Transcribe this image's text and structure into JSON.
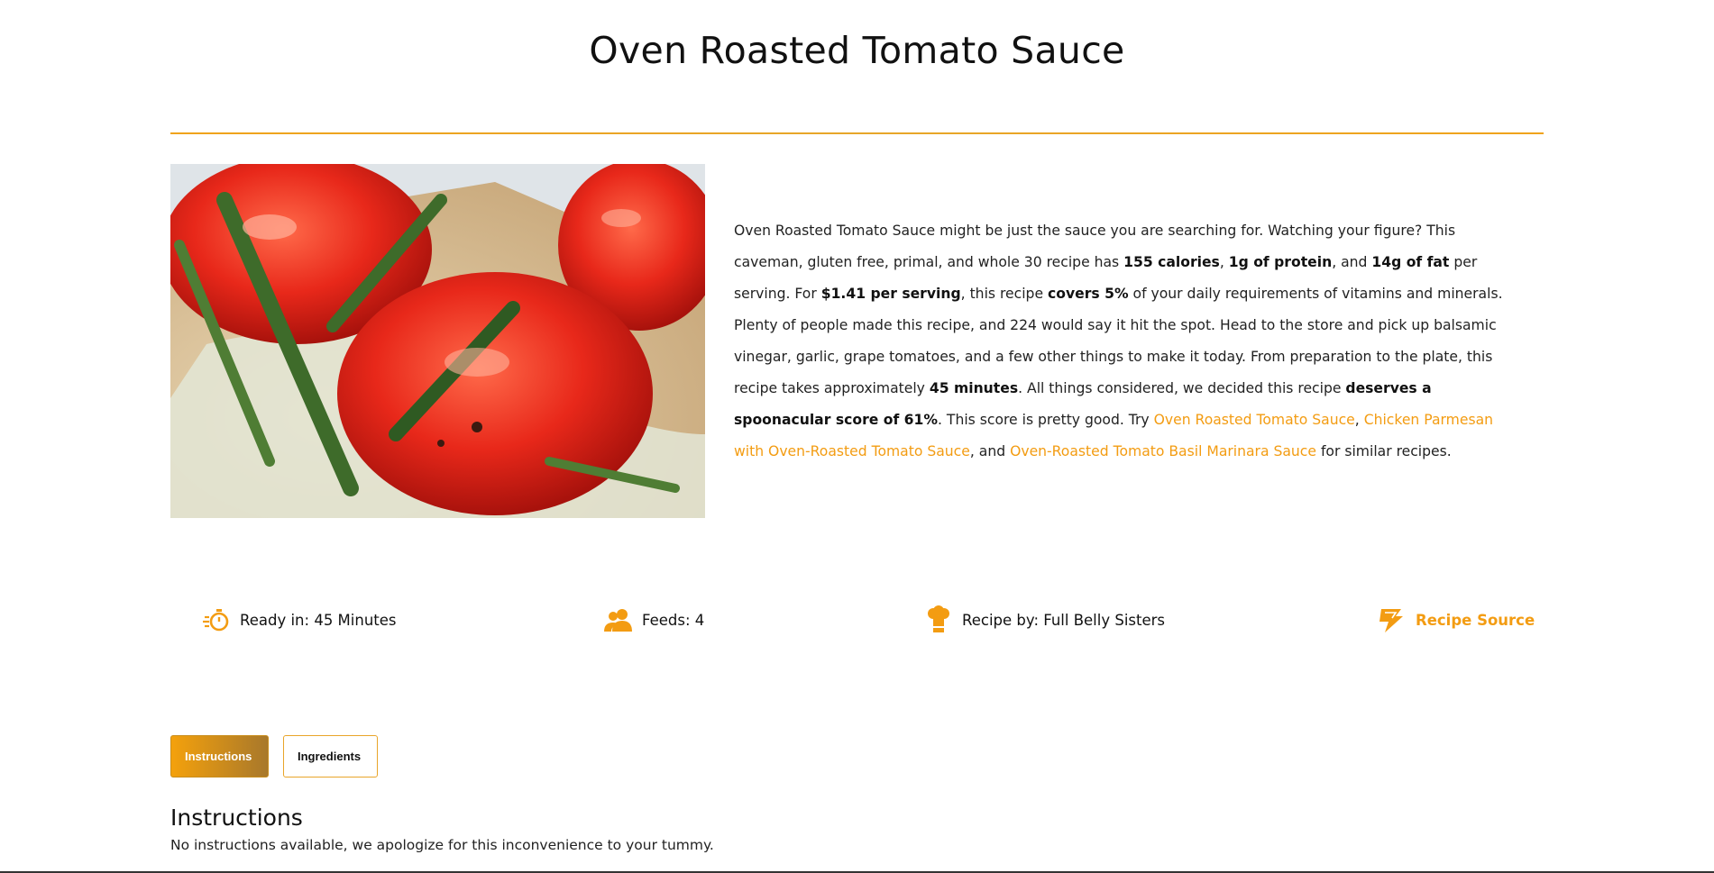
{
  "recipe": {
    "title": "Oven Roasted Tomato Sauce"
  },
  "summary": {
    "p1": "Oven Roasted Tomato Sauce might be just the sauce you are searching for. Watching your figure? This caveman, gluten free, primal, and whole 30 recipe has ",
    "b1": "155 calories",
    "p2": ", ",
    "b2": "1g of protein",
    "p3": ", and ",
    "b3": "14g of fat",
    "p4": " per serving. For ",
    "b4": "$1.41 per serving",
    "p5": ", this recipe ",
    "b5": "covers 5%",
    "p6": " of your daily requirements of vitamins and minerals. Plenty of people made this recipe, and 224 would say it hit the spot. Head to the store and pick up balsamic vinegar, garlic, grape tomatoes, and a few other things to make it today. From preparation to the plate, this recipe takes approximately ",
    "b6": "45 minutes",
    "p7": ". All things considered, we decided this recipe ",
    "b7": "deserves a spoonacular score of 61%",
    "p8": ". This score is pretty good. Try ",
    "link1": "Oven Roasted Tomato Sauce",
    "p9": ", ",
    "link2": "Chicken Parmesan with Oven-Roasted Tomato Sauce",
    "p10": ", and ",
    "link3": "Oven-Roasted Tomato Basil Marinara Sauce",
    "p11": " for similar recipes."
  },
  "meta": {
    "ready": "Ready in: 45 Minutes",
    "feeds": "Feeds: 4",
    "author": "Recipe by: Full Belly Sisters",
    "source": "Recipe Source",
    "icons": {
      "ready": "stopwatch-icon",
      "feeds": "users-icon",
      "author": "chef-hat-icon",
      "source": "source-link-icon"
    }
  },
  "tabs": {
    "instructions": "Instructions",
    "ingredients": "Ingredients"
  },
  "section": {
    "heading": "Instructions",
    "text": "No instructions available, we apologize for this inconvenience to your tummy."
  },
  "colors": {
    "accent": "#f39c12",
    "divider": "#f0a31b",
    "text": "#222222"
  }
}
